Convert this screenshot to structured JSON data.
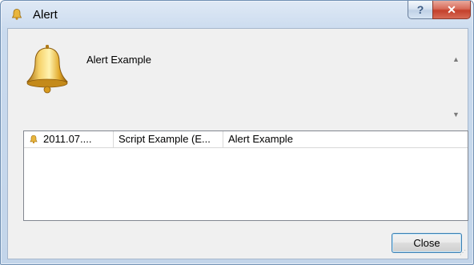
{
  "window": {
    "title": "Alert",
    "help_label": "?",
    "close_label": "✕"
  },
  "message": {
    "text": "Alert Example"
  },
  "scrollbar": {
    "up_arrow": "▲",
    "down_arrow": "▼"
  },
  "alerts_list": {
    "rows": [
      {
        "icon": "bell-icon",
        "time": "2011.07....",
        "source": "Script Example (E...",
        "message": "Alert Example"
      }
    ]
  },
  "buttons": {
    "close": "Close"
  },
  "colors": {
    "bell_gold": "#d6a21e",
    "title_bar": "#c9daee",
    "close_red": "#c4402b"
  }
}
